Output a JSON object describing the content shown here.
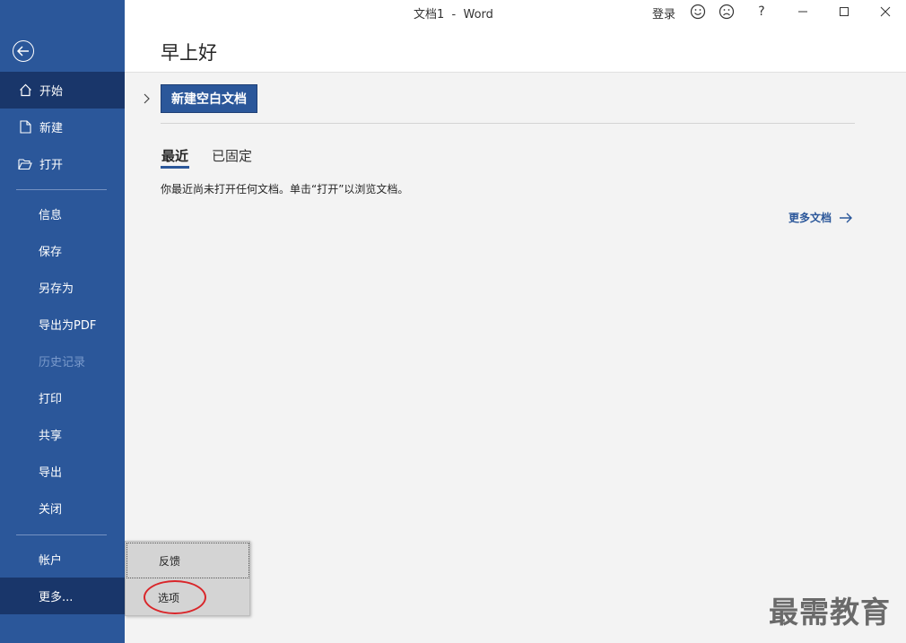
{
  "window": {
    "doc_title": "文档1  -  Word",
    "login_label": "登录",
    "help_label": "?"
  },
  "header": {
    "greeting": "早上好"
  },
  "sidebar": {
    "items": [
      {
        "label": "开始",
        "icon": "home-icon"
      },
      {
        "label": "新建",
        "icon": "new-document-icon"
      },
      {
        "label": "打开",
        "icon": "folder-open-icon"
      },
      {
        "label": "信息"
      },
      {
        "label": "保存"
      },
      {
        "label": "另存为"
      },
      {
        "label": "导出为PDF"
      },
      {
        "label": "历史记录"
      },
      {
        "label": "打印"
      },
      {
        "label": "共享"
      },
      {
        "label": "导出"
      },
      {
        "label": "关闭"
      },
      {
        "label": "帐户"
      },
      {
        "label": "更多..."
      }
    ]
  },
  "main": {
    "new_blank_label": "新建空白文档",
    "tabs": [
      {
        "label": "最近"
      },
      {
        "label": "已固定"
      }
    ],
    "empty_message": "你最近尚未打开任何文档。单击“打开”以浏览文档。",
    "more_docs_label": "更多文档"
  },
  "popup": {
    "items": [
      {
        "label": "反馈"
      },
      {
        "label": "选项"
      }
    ]
  },
  "watermark": "最需教育",
  "colors": {
    "accent": "#2b579a",
    "accent_dark": "#19366a",
    "highlight_circle": "#d9262a"
  }
}
